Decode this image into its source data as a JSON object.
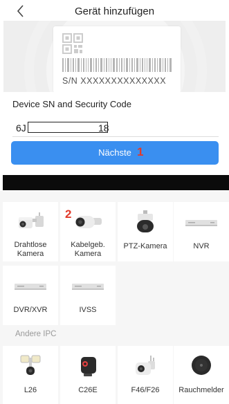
{
  "header": {
    "title": "Gerät hinzufügen",
    "back_icon": "back-chevron-icon"
  },
  "banner": {
    "sn_label_text": "S/N  XXXXXXXXXXXXXX"
  },
  "form": {
    "label": "Device SN and Security Code",
    "sn_prefix": "6J",
    "sn_suffix": "18"
  },
  "next_button": {
    "label": "Nächste"
  },
  "markers": {
    "one": "1",
    "two": "2"
  },
  "devices": [
    {
      "label": "Drahtlose\nKamera",
      "icon": "wireless-camera-icon"
    },
    {
      "label": "Kabelgeb.\nKamera",
      "icon": "wired-camera-icon"
    },
    {
      "label": "PTZ-Kamera",
      "icon": "ptz-camera-icon"
    },
    {
      "label": "NVR",
      "icon": "nvr-icon"
    },
    {
      "label": "DVR/XVR",
      "icon": "dvr-icon"
    },
    {
      "label": "IVSS",
      "icon": "ivss-icon"
    }
  ],
  "section_other": "Andere IPC",
  "other_devices": [
    {
      "label": "L26",
      "icon": "floodlight-camera-icon"
    },
    {
      "label": "C26E",
      "icon": "cube-camera-icon"
    },
    {
      "label": "F46/F26",
      "icon": "spotlight-camera-icon"
    },
    {
      "label": "Rauchmelder",
      "icon": "smoke-detector-icon"
    }
  ],
  "colors": {
    "accent": "#3a8ff0",
    "marker": "#e23a2a",
    "redaction": "#0b0b0b"
  }
}
